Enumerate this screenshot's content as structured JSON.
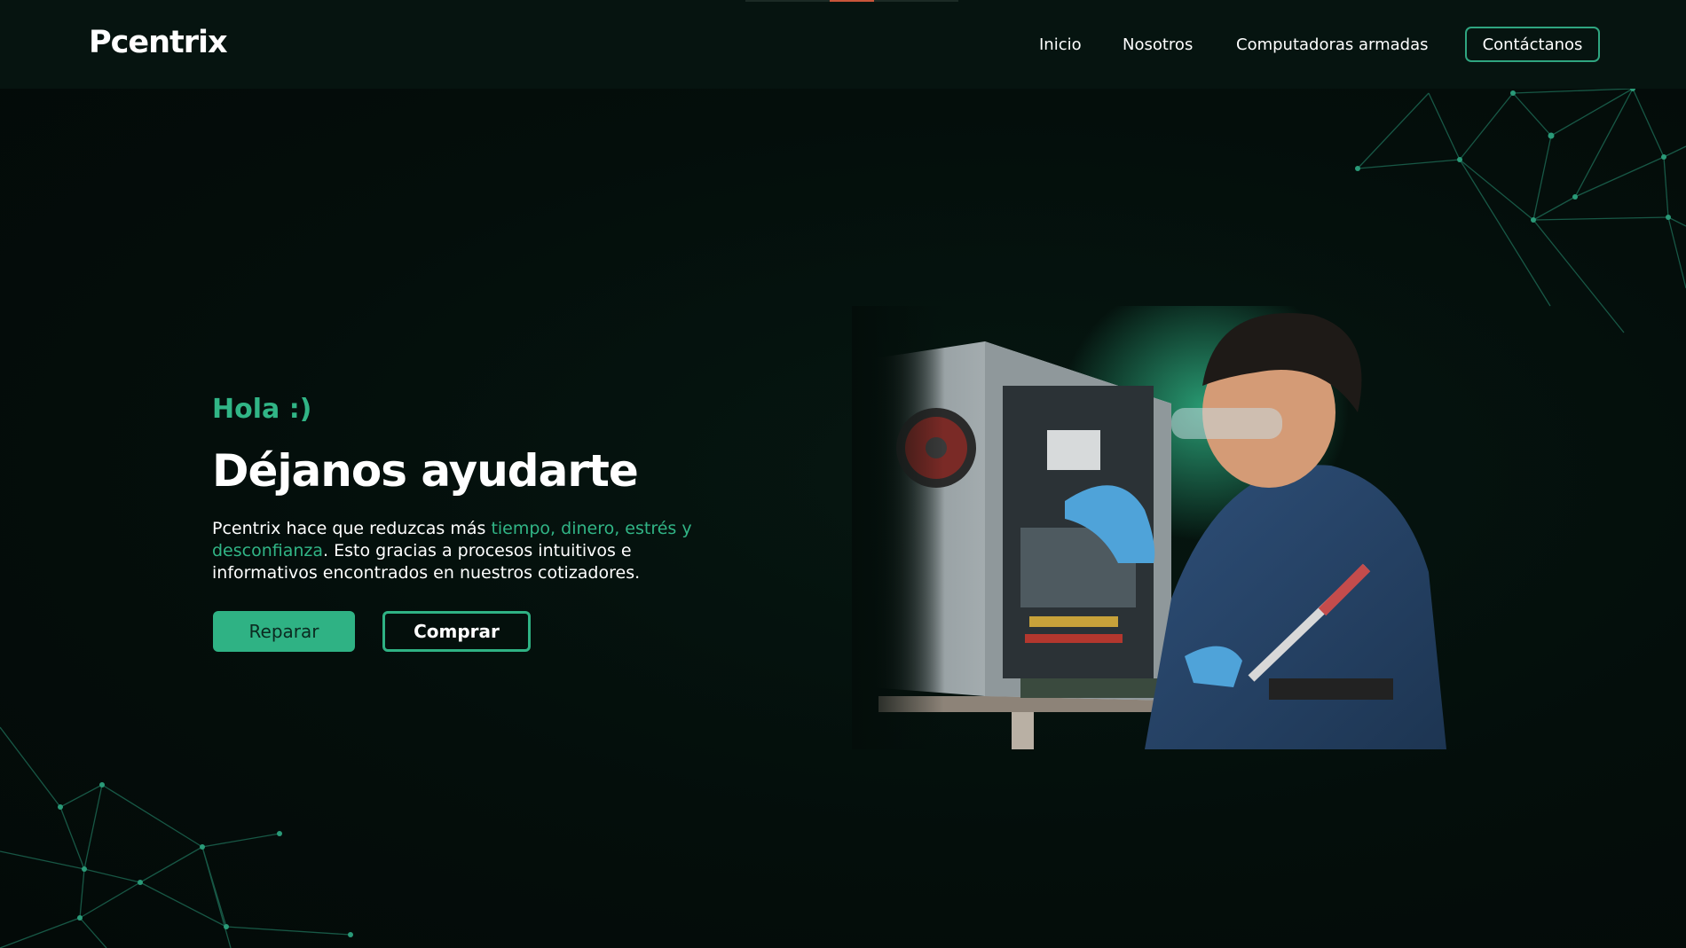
{
  "brand": {
    "name": "Pcentrix"
  },
  "nav": {
    "items": [
      {
        "label": "Inicio"
      },
      {
        "label": "Nosotros"
      },
      {
        "label": "Computadoras armadas"
      }
    ],
    "contact_label": "Contáctanos"
  },
  "hero": {
    "greeting": "Hola :)",
    "headline": "Déjanos ayudarte",
    "description": {
      "part1": "Pcentrix hace que reduzcas más ",
      "highlight": "tiempo, dinero, estrés y desconfianza",
      "part2": ". Esto gracias a procesos intuitivos e informativos encontrados en nuestros cotizadores."
    },
    "primary_button": "Reparar",
    "secondary_button": "Comprar"
  },
  "colors": {
    "accent": "#2fb284",
    "background": "#040d0a",
    "header": "#061410"
  },
  "icons": {
    "hero_image": "technician-repairing-computer",
    "decoration": "network-mesh-lines"
  }
}
